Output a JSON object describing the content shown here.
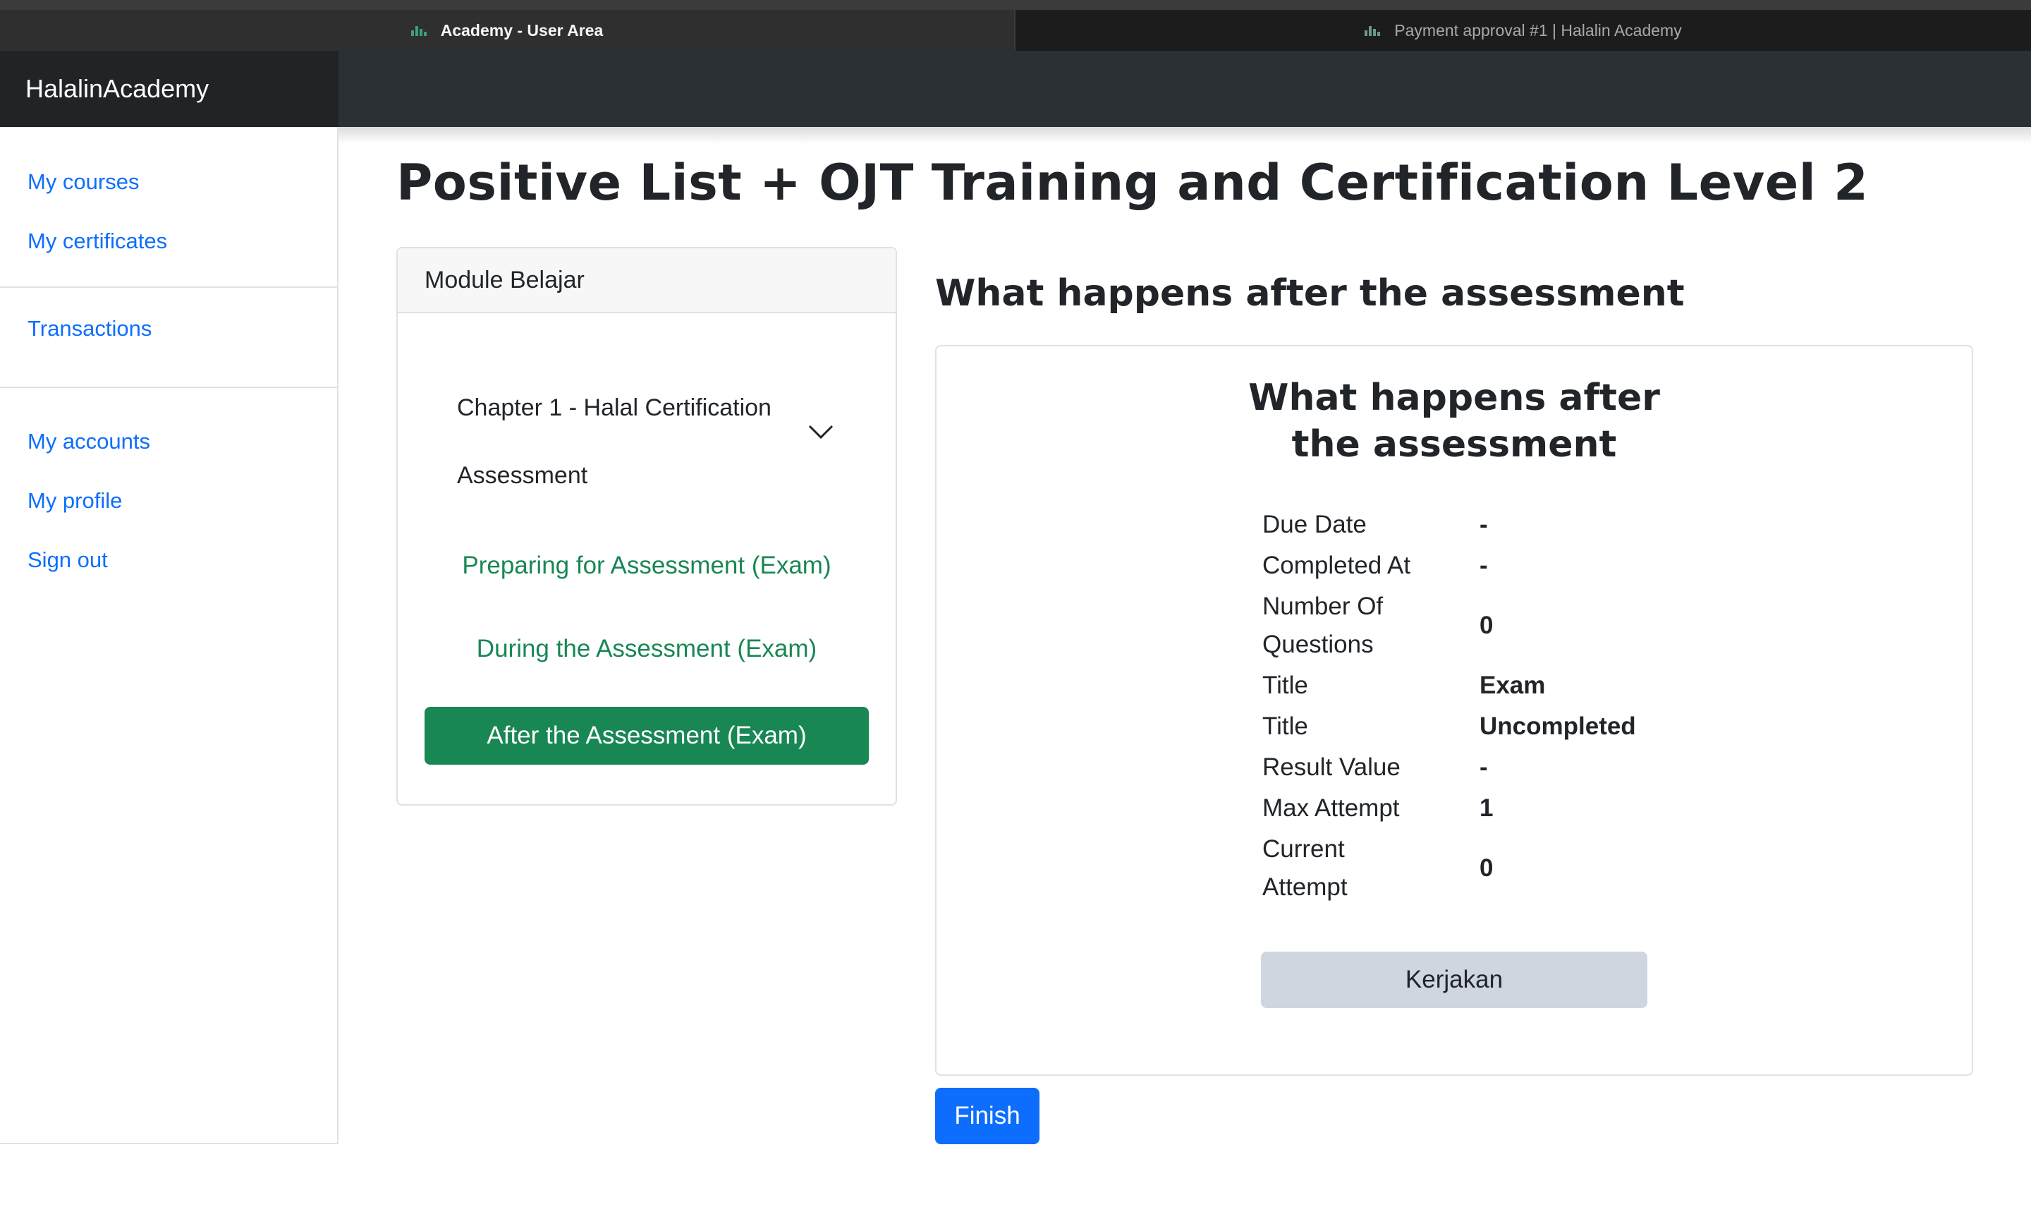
{
  "browser": {
    "tabs": [
      {
        "label": "Academy - User Area",
        "icon": "academy-favicon",
        "active": true
      },
      {
        "label": "Payment approval #1 | Halalin Academy",
        "icon": "academy-favicon",
        "active": false
      }
    ]
  },
  "navbar": {
    "brand": "HalalinAcademy"
  },
  "sidebar": {
    "group1": [
      "My courses",
      "My certificates"
    ],
    "group2": [
      "Transactions"
    ],
    "group3": [
      "My accounts",
      "My profile",
      "Sign out"
    ]
  },
  "page": {
    "title": "Positive List + OJT Training and Certification Level 2"
  },
  "module": {
    "header": "Module Belajar",
    "chapter": "Chapter 1 - Halal Certification Assessment",
    "chapter_icon": "chevron-down-icon",
    "lessons": [
      "Preparing for Assessment (Exam)",
      "During the Assessment (Exam)",
      "After the Assessment (Exam)"
    ],
    "active_lesson": "After the Assessment (Exam)"
  },
  "content": {
    "heading": "What happens after the assessment",
    "card_title_line1": "What happens after",
    "card_title_line2": "the assessment",
    "details": [
      {
        "label": "Due Date",
        "value": "-"
      },
      {
        "label": "Completed At",
        "value": "-"
      },
      {
        "label": "Number Of Questions",
        "value": "0"
      },
      {
        "label": "Title",
        "value": "Exam"
      },
      {
        "label": "Title",
        "value": "Uncompleted"
      },
      {
        "label": "Result Value",
        "value": "-"
      },
      {
        "label": "Max Attempt",
        "value": "1"
      },
      {
        "label": "Current Attempt",
        "value": "0"
      }
    ],
    "start_button": "Kerjakan",
    "finish_button": "Finish"
  },
  "colors": {
    "brand_bar": "#212427",
    "link_blue": "#0d6efd",
    "lesson_green": "#198754",
    "kerjakan_bg": "#cfd6df"
  }
}
